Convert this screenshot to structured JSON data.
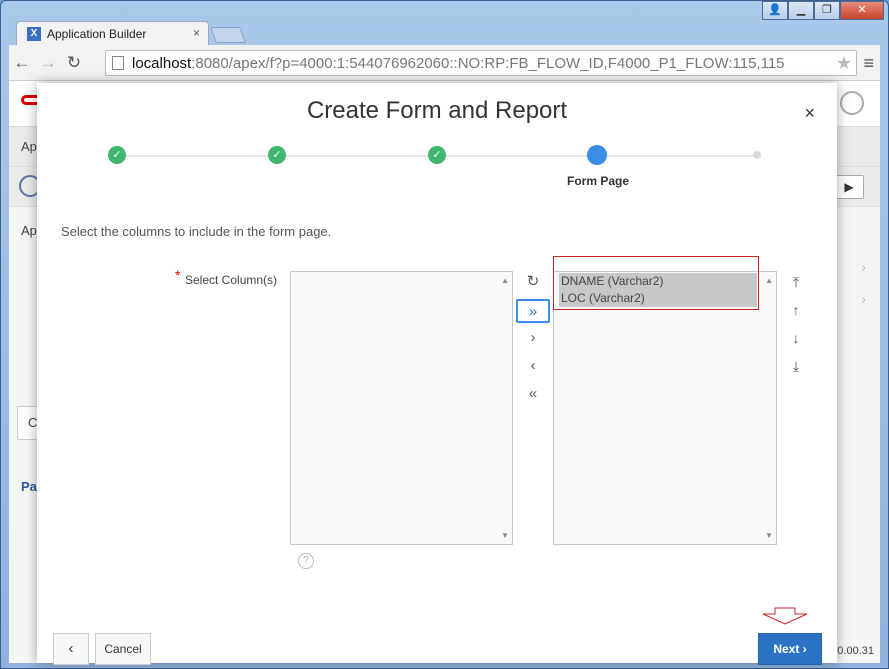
{
  "browser": {
    "tab_title": "Application Builder",
    "tab_icon": "X",
    "tab_close": "×",
    "url_host": "localhost",
    "url_path": ":8080/apex/f?p=4000:1:544076962060::NO:RP:FB_FLOW_ID,F4000_P1_FLOW:115,115",
    "back_glyph": "←",
    "forward_glyph": "→",
    "reload_glyph": "↻",
    "star_glyph": "★",
    "menu_glyph": "≡",
    "win_minimize": "▁",
    "win_restore": "❐",
    "win_close": "✕",
    "win_user": "👤"
  },
  "background_page": {
    "crumb": "Ap",
    "section": "Ap",
    "link": "Pa",
    "version": ".0.00.31",
    "play_glyph": "▶",
    "search_glyph": "C",
    "chevron_glyph": "›"
  },
  "dialog": {
    "title": "Create Form and Report",
    "close_glyph": "×",
    "steps": [
      {
        "label": "",
        "state": "done",
        "glyph": "✓"
      },
      {
        "label": "",
        "state": "done",
        "glyph": "✓"
      },
      {
        "label": "",
        "state": "done",
        "glyph": "✓"
      },
      {
        "label": "Form Page",
        "state": "current",
        "glyph": ""
      },
      {
        "label": "",
        "state": "future",
        "glyph": ""
      }
    ],
    "instruction": "Select the columns to include in the form page.",
    "field_label": "Select Column(s)",
    "required_mark": "*",
    "available_columns": [],
    "selected_columns": [
      "DNAME (Varchar2)",
      "LOC (Varchar2)"
    ],
    "shuttle": {
      "reset": "↻",
      "move_all": "»",
      "move": "›",
      "remove": "‹",
      "remove_all": "«"
    },
    "order": {
      "top": "⤒",
      "up": "↑",
      "down": "↓",
      "bottom": "⤓"
    },
    "scroll_up": "▲",
    "scroll_down": "▼",
    "help_glyph": "?",
    "footer": {
      "back_glyph": "‹",
      "cancel": "Cancel",
      "next": "Next ›"
    }
  },
  "colors": {
    "accent": "#2d73c3",
    "step_done": "#3eb66e",
    "step_current": "#3a8ee6",
    "highlight": "#c92424"
  }
}
